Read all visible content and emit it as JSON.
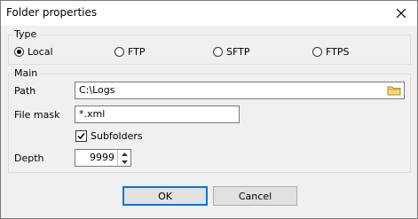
{
  "window": {
    "title": "Folder properties",
    "close_icon": "close-icon"
  },
  "type_group": {
    "label": "Type",
    "options": [
      {
        "label": "Local",
        "selected": true
      },
      {
        "label": "FTP",
        "selected": false
      },
      {
        "label": "SFTP",
        "selected": false
      },
      {
        "label": "FTPS",
        "selected": false
      }
    ]
  },
  "main_group": {
    "label": "Main",
    "path_label": "Path",
    "path_value": "C:\\Logs",
    "browse_icon": "folder-icon",
    "filemask_label": "File mask",
    "filemask_value": "*.xml",
    "subfolders_label": "Subfolders",
    "subfolders_checked": true,
    "depth_label": "Depth",
    "depth_value": "9999"
  },
  "buttons": {
    "ok": "OK",
    "cancel": "Cancel"
  },
  "colors": {
    "accent": "#0078d7",
    "window_bg": "#f0f0f0"
  }
}
